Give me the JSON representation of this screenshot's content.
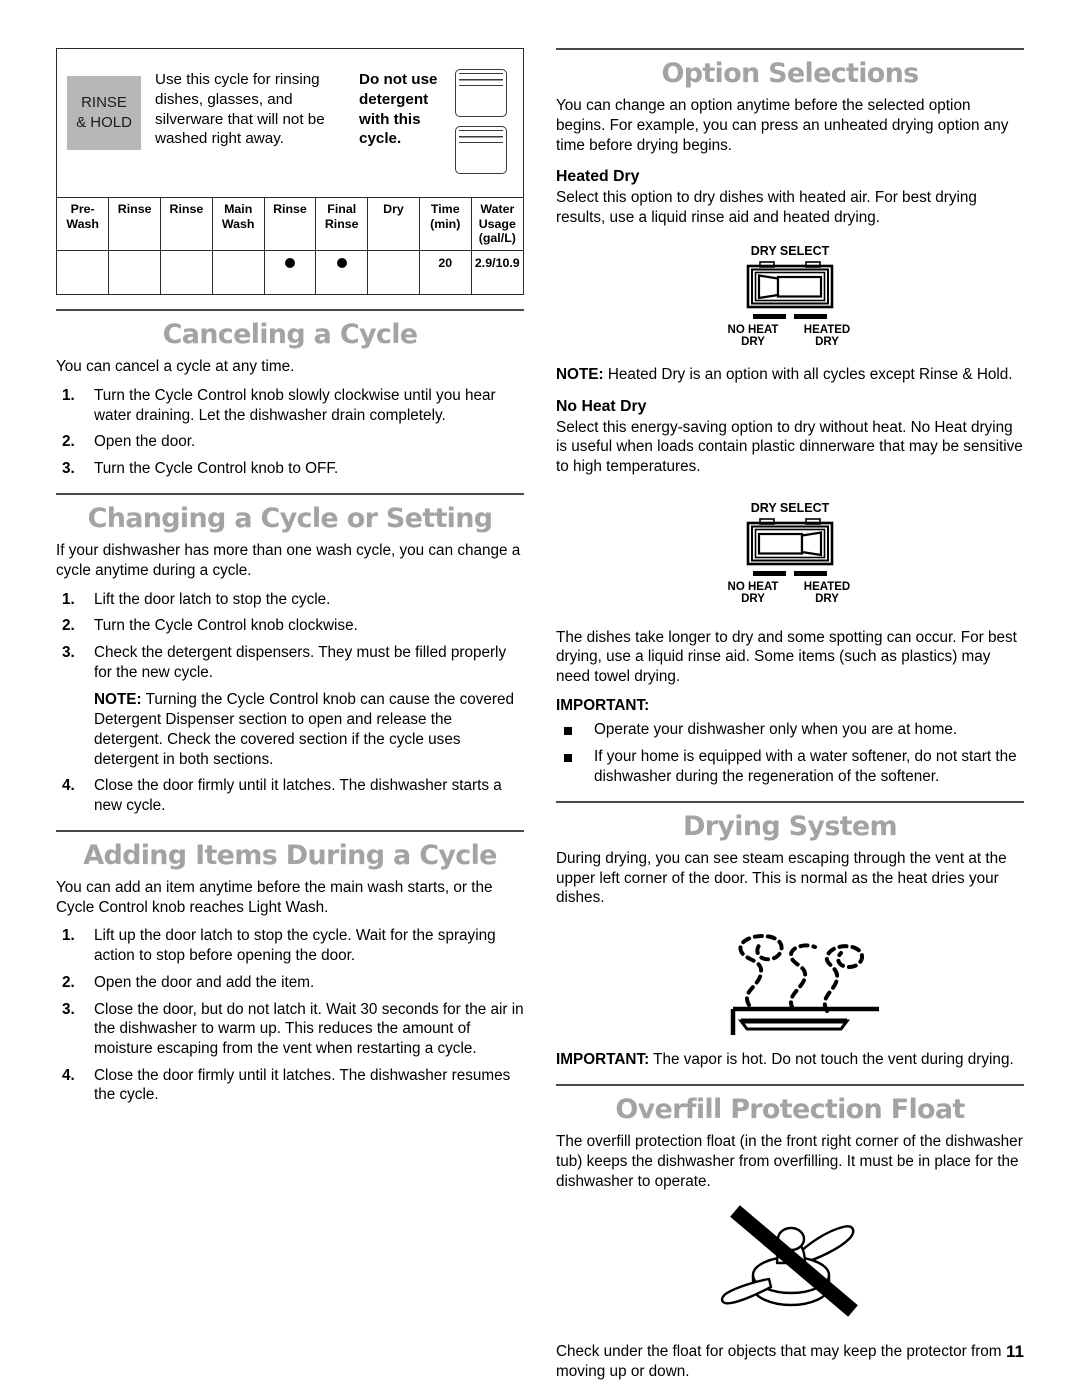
{
  "page": {
    "number": "11"
  },
  "cycle_panel": {
    "badge_line1": "RINSE",
    "badge_line2": "& HOLD",
    "description": "Use this cycle for rinsing dishes, glasses, and silverware that will not be washed right away.",
    "warning": "Do not use detergent with this cycle.",
    "dispenser_icon_1": "detergent-cup-icon",
    "dispenser_icon_2": "detergent-cup-icon",
    "table": {
      "headers": [
        "Pre-Wash",
        "Rinse",
        "Rinse",
        "Main Wash",
        "Rinse",
        "Final Rinse",
        "Dry",
        "Time (min)",
        "Water Usage (gal/L)"
      ],
      "headers_lines": [
        [
          "Pre-",
          "Wash"
        ],
        [
          "Rinse"
        ],
        [
          "Rinse"
        ],
        [
          "Main",
          "Wash"
        ],
        [
          "Rinse"
        ],
        [
          "Final",
          "Rinse"
        ],
        [
          "Dry"
        ],
        [
          "Time",
          "(min)"
        ],
        [
          "Water",
          "Usage",
          "(gal/L)"
        ]
      ],
      "row": [
        "",
        "",
        "",
        "",
        "dot",
        "dot",
        "",
        "20",
        "2.9/10.9"
      ]
    }
  },
  "canceling": {
    "title": "Canceling a Cycle",
    "intro": "You can cancel a cycle at any time.",
    "steps": [
      "Turn the Cycle Control knob slowly clockwise until you hear water draining. Let the dishwasher drain completely.",
      "Open the door.",
      "Turn the Cycle Control knob to OFF."
    ]
  },
  "changing": {
    "title": "Changing a Cycle or Setting",
    "intro": "If your dishwasher has more than one wash cycle, you can change a cycle anytime during a cycle.",
    "steps": [
      "Lift the door latch to stop the cycle.",
      "Turn the Cycle Control knob clockwise.",
      "Check the detergent dispensers. They must be filled properly for the new cycle.",
      "Close the door firmly until it latches. The dishwasher starts a new cycle."
    ],
    "note_label": "NOTE:",
    "note_text": " Turning the Cycle Control knob can cause the covered Detergent Dispenser section to open and release the detergent. Check the covered section if the cycle uses detergent in both sections."
  },
  "adding": {
    "title": "Adding Items During a Cycle",
    "intro": "You can add an item anytime before the main wash starts, or the Cycle Control knob reaches Light Wash.",
    "steps": [
      "Lift up the door latch to stop the cycle. Wait for the spraying action to stop before opening the door.",
      "Open the door and add the item.",
      "Close the door, but do not latch it. Wait 30 seconds for the air in the dishwasher to warm up. This reduces the amount of moisture escaping from the vent when restarting a cycle.",
      "Close the door firmly until it latches. The dishwasher resumes the cycle."
    ]
  },
  "option_selections": {
    "title": "Option Selections",
    "intro": "You can change an option anytime before the selected option begins. For example, you can press an unheated drying option any time before drying begins.",
    "heated_dry": {
      "heading": "Heated Dry",
      "text": "Select this option to dry dishes with heated air. For best drying results, use a liquid rinse aid and heated drying.",
      "note_label": "NOTE:",
      "note_text": " Heated Dry is an option with all cycles except Rinse & Hold."
    },
    "no_heat_dry": {
      "heading": "No Heat Dry",
      "text": "Select this energy-saving option to dry without heat. No Heat drying is useful when loads contain plastic dinnerware that may be sensitive to high temperatures.",
      "text2": "The dishes take longer to dry and some spotting can occur. For best drying, use a liquid rinse aid. Some items (such as plastics) may need towel drying."
    },
    "switch_figure": {
      "title": "DRY SELECT",
      "left_label_line1": "NO HEAT",
      "left_label_line2": "DRY",
      "right_label_line1": "HEATED",
      "right_label_line2": "DRY",
      "position_heated": "right",
      "position_no_heat": "left"
    },
    "important_label": "IMPORTANT:",
    "important_items": [
      "Operate your dishwasher only when you are at home.",
      "If your home is equipped with a water softener, do not start the dishwasher during the regeneration of the softener."
    ]
  },
  "drying_system": {
    "title": "Drying System",
    "text": "During drying, you can see steam escaping through the vent at the upper left corner of the door. This is normal as the heat dries your dishes.",
    "important_label": "IMPORTANT:",
    "important_text": " The vapor is hot. Do not touch the vent during drying.",
    "figure_name": "steam-vent-illustration"
  },
  "overfill_float": {
    "title": "Overfill Protection Float",
    "text": "The overfill protection float (in the front right corner of the dishwasher tub) keeps the dishwasher from overfilling. It must be in place for the dishwasher to operate.",
    "text2": "Check under the float for objects that may keep the protector from moving up or down.",
    "figure_name": "float-obstruction-prohibited-illustration"
  },
  "colors": {
    "heading_gray": "#a3a3a3",
    "badge_gray": "#b7b7b7",
    "rule_dark": "#4a4a4a",
    "text_black": "#000000"
  }
}
